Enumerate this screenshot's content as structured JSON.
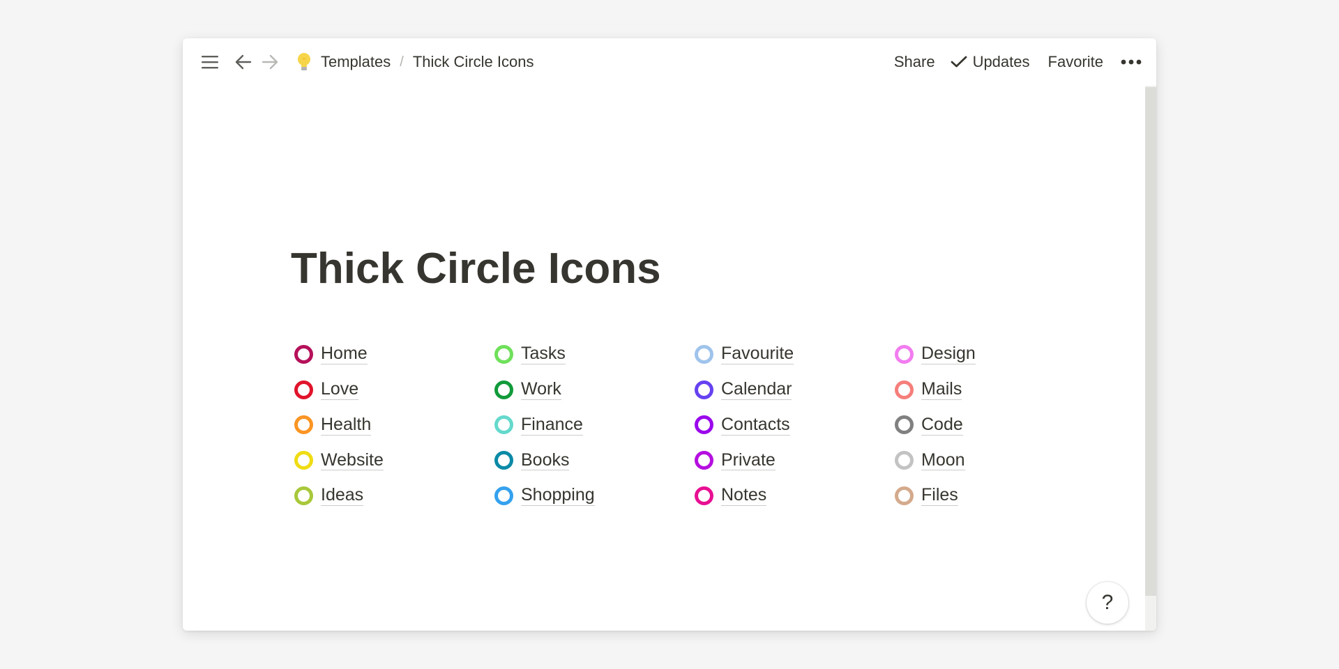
{
  "topbar": {
    "menu_icon": "hamburger-menu-icon",
    "back_icon": "arrow-left-icon",
    "forward_icon": "arrow-right-icon",
    "page_icon": "lightbulb-icon",
    "breadcrumb": [
      "Templates",
      "Thick Circle Icons"
    ],
    "breadcrumb_separator": "/",
    "share_label": "Share",
    "updates_label": "Updates",
    "favorite_label": "Favorite",
    "more_icon": "ellipsis-icon"
  },
  "page": {
    "title": "Thick Circle Icons"
  },
  "items": [
    {
      "label": "Home",
      "color": "#b5115a"
    },
    {
      "label": "Tasks",
      "color": "#6fe05a"
    },
    {
      "label": "Favourite",
      "color": "#9fc4ec"
    },
    {
      "label": "Design",
      "color": "#f27cf0"
    },
    {
      "label": "Love",
      "color": "#e0142b"
    },
    {
      "label": "Work",
      "color": "#119a3a"
    },
    {
      "label": "Calendar",
      "color": "#6742f0"
    },
    {
      "label": "Mails",
      "color": "#f57f7b"
    },
    {
      "label": "Health",
      "color": "#fb9523"
    },
    {
      "label": "Finance",
      "color": "#64d9cc"
    },
    {
      "label": "Contacts",
      "color": "#9b08ec"
    },
    {
      "label": "Code",
      "color": "#808080"
    },
    {
      "label": "Website",
      "color": "#f0dc14"
    },
    {
      "label": "Books",
      "color": "#0b8aa6"
    },
    {
      "label": "Private",
      "color": "#b50fe0"
    },
    {
      "label": "Moon",
      "color": "#c3c3c3"
    },
    {
      "label": "Ideas",
      "color": "#a8c83a"
    },
    {
      "label": "Shopping",
      "color": "#35a1ee"
    },
    {
      "label": "Notes",
      "color": "#e80f92"
    },
    {
      "label": "Files",
      "color": "#d4aa8c"
    }
  ],
  "help": {
    "label": "?"
  }
}
